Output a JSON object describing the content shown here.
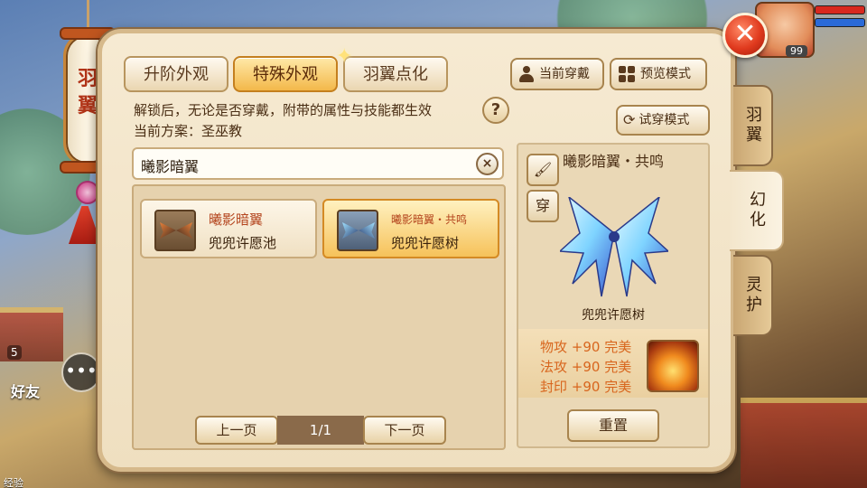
{
  "lantern": {
    "text": "羽翼"
  },
  "friends": {
    "label": "好友",
    "count": "5"
  },
  "footer": {
    "exp_label": "经验"
  },
  "hud": {
    "level": "99",
    "hp_color": "#d8281e",
    "mp_color": "#2a6ad8"
  },
  "tabs": [
    {
      "label": "升阶外观",
      "active": false
    },
    {
      "label": "特殊外观",
      "active": true
    },
    {
      "label": "羽翼点化",
      "active": false
    }
  ],
  "header_buttons": {
    "current_wear": "当前穿戴",
    "preview_mode": "预览模式"
  },
  "info": {
    "notice": "解锁后，无论是否穿戴，附带的属性与技能都生效",
    "current_plan": "当前方案：圣巫教"
  },
  "search": {
    "value": "曦影暗翼",
    "clear_icon": "×"
  },
  "list": {
    "items": [
      {
        "name": "曦影暗翼",
        "source": "兜兜许愿池",
        "selected": false
      },
      {
        "name": "曦影暗翼・共鸣",
        "source": "兜兜许愿树",
        "selected": true
      }
    ]
  },
  "pagination": {
    "prev": "上一页",
    "page": "1/1",
    "next": "下一页"
  },
  "preview": {
    "try_mode": "试穿模式",
    "title": "曦影暗翼・共鸣",
    "wear_btn": "穿",
    "source": "兜兜许愿树",
    "attrs": [
      "物攻 +90 完美",
      "法攻 +90 完美",
      "封印 +90 完美"
    ],
    "reset": "重置"
  },
  "side_tabs": [
    {
      "label": "羽翼",
      "active": false
    },
    {
      "label": "幻化",
      "active": true
    },
    {
      "label": "灵护",
      "active": false
    }
  ],
  "icons": {
    "close": "close-icon",
    "help": "?",
    "brush": "brush-icon",
    "person": "person-icon",
    "grid": "grid-icon",
    "refresh": "refresh-icon"
  }
}
